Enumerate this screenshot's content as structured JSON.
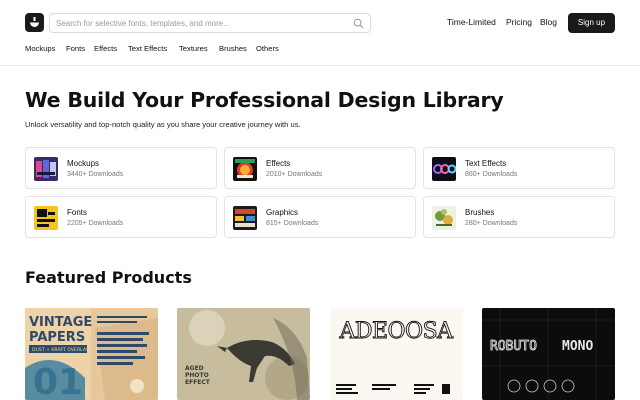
{
  "header": {
    "search_placeholder": "Search for selective fonts, templates, and more...",
    "nav": [
      "Time-Limited",
      "Pricing",
      "Blog"
    ],
    "signup_label": "Sign up"
  },
  "categories_nav": [
    "Mockups",
    "Fonts",
    "Effects",
    "Text Effects",
    "Textures",
    "Brushes",
    "Others"
  ],
  "hero": {
    "title": "We Build Your Professional Design Library",
    "subtitle": "Unlock versatility and top-notch quality as you share your creative journey with us."
  },
  "category_cards": [
    {
      "name": "Mockups",
      "count": "3440+ Downloads"
    },
    {
      "name": "Effects",
      "count": "2010+ Downloads"
    },
    {
      "name": "Text Effects",
      "count": "860+ Downloads"
    },
    {
      "name": "Fonts",
      "count": "2205+ Downloads"
    },
    {
      "name": "Graphics",
      "count": "815+ Downloads"
    },
    {
      "name": "Brushes",
      "count": "280+ Downloads"
    }
  ],
  "featured": {
    "title": "Featured Products",
    "products": [
      {
        "name": "Vintage Papers",
        "art_text": [
          "VINTAGE",
          "PAPERS",
          "DUST + KRAFT OVERLAY",
          "01"
        ]
      },
      {
        "name": "Aged Photo Effect",
        "art_text": [
          "AGED",
          "PHOTO",
          "EFFECT"
        ]
      },
      {
        "name": "Adeoosa",
        "art_text": [
          "ADEOOSA"
        ]
      },
      {
        "name": "Roboto Mono",
        "art_text": [
          "ROBUTO",
          "MONO"
        ]
      }
    ]
  },
  "icons": {
    "logo": "brand-logo-icon",
    "search": "search-icon"
  }
}
